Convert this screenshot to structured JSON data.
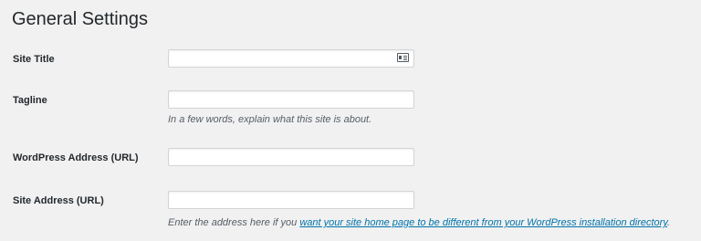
{
  "page": {
    "title": "General Settings"
  },
  "fields": {
    "site_title": {
      "label": "Site Title",
      "value": ""
    },
    "tagline": {
      "label": "Tagline",
      "value": "",
      "description": "In a few words, explain what this site is about."
    },
    "wordpress_address": {
      "label": "WordPress Address (URL)",
      "value": ""
    },
    "site_address": {
      "label": "Site Address (URL)",
      "value": "",
      "description_prefix": "Enter the address here if you ",
      "description_link": "want your site home page to be different from your WordPress installation directory",
      "description_suffix": "."
    }
  },
  "icons": {
    "autofill": "contact-card-icon"
  },
  "colors": {
    "background": "#f1f1f1",
    "text": "#23282d",
    "description": "#555d66",
    "link": "#0073aa",
    "field_border": "#d4d4d4"
  }
}
